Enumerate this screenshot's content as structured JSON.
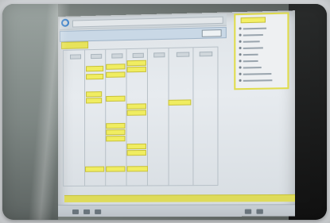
{
  "photo": {
    "subject": "",
    "app_window": {
      "header_button_label": "",
      "tag_label": ""
    },
    "menu_panel": {
      "title": "",
      "items": [
        "",
        "",
        "",
        "",
        "",
        "",
        "",
        "",
        ""
      ]
    },
    "timeline": {
      "columns": [
        "",
        "",
        "",
        "",
        "",
        "",
        ""
      ],
      "task_bars": [
        "",
        "",
        "",
        "",
        "",
        "",
        "",
        "",
        "",
        "",
        "",
        "",
        "",
        "",
        "",
        "",
        "",
        "",
        "",
        ""
      ]
    }
  }
}
